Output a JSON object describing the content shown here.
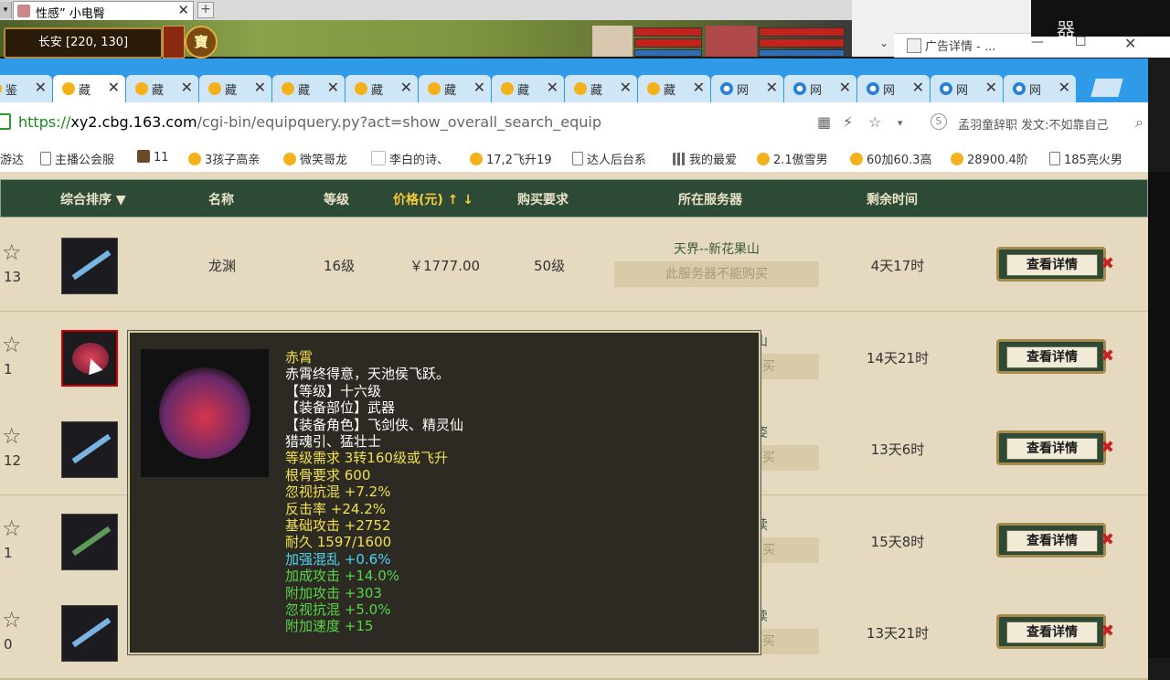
{
  "game": {
    "tab_title": "性感” 小电臀",
    "location": "长安 [220, 130]",
    "bao_badge": "寶"
  },
  "popup": {
    "title": "广告详情 - ...",
    "min": "—",
    "max": "☐",
    "close": "✕",
    "chev": "⌄",
    "watermark": "器"
  },
  "browser": {
    "tabs": [
      {
        "label": "鉴",
        "type": "game"
      },
      {
        "label": "藏",
        "type": "game",
        "active": true
      },
      {
        "label": "藏",
        "type": "game"
      },
      {
        "label": "藏",
        "type": "game"
      },
      {
        "label": "藏",
        "type": "game"
      },
      {
        "label": "藏",
        "type": "game"
      },
      {
        "label": "藏",
        "type": "game"
      },
      {
        "label": "藏",
        "type": "game"
      },
      {
        "label": "藏",
        "type": "game"
      },
      {
        "label": "藏",
        "type": "game"
      },
      {
        "label": "网",
        "type": "ie"
      },
      {
        "label": "网",
        "type": "ie"
      },
      {
        "label": "网",
        "type": "ie"
      },
      {
        "label": "网",
        "type": "ie"
      },
      {
        "label": "网",
        "type": "ie"
      }
    ],
    "url_scheme": "https://",
    "url_domain": "xy2.cbg.163.com",
    "url_path": "/cgi-bin/equipquery.py?act=show_overall_search_equip",
    "user_text": "孟羽童辞职 发文:不如靠自己",
    "bookmarks": [
      {
        "label": "游达",
        "icon": "none"
      },
      {
        "label": "主播公会服",
        "icon": "page"
      },
      {
        "label": "11",
        "icon": "img"
      },
      {
        "label": "3孩子高亲",
        "icon": "star"
      },
      {
        "label": "微笑哥龙",
        "icon": "star"
      },
      {
        "label": "李白的诗、",
        "icon": "gu"
      },
      {
        "label": "17,2飞升19",
        "icon": "star"
      },
      {
        "label": "达人后台系",
        "icon": "page"
      },
      {
        "label": "我的最爱",
        "icon": "grid"
      },
      {
        "label": "2.1傲雪男",
        "icon": "star"
      },
      {
        "label": "60加60.3高",
        "icon": "star"
      },
      {
        "label": "28900.4阶",
        "icon": "star"
      },
      {
        "label": "185亮火男",
        "icon": "page"
      }
    ]
  },
  "table": {
    "headers": {
      "sort": "综合排序 ▼",
      "name": "名称",
      "level": "等级",
      "price": "价格(元) ↑ ↓",
      "req": "购买要求",
      "server": "所在服务器",
      "time": "剩余时间"
    },
    "rows": [
      {
        "count": "13",
        "name": "龙渊",
        "level": "16级",
        "price": "￥1777.00",
        "req": "50级",
        "server": "天界--新花果山",
        "server_note": "此服务器不能购买",
        "time": "4天17时",
        "btn": "查看详情"
      },
      {
        "count": "1",
        "server": "山",
        "server_note": "买",
        "time": "14天21时",
        "btn": "查看详情"
      },
      {
        "count": "12",
        "server": "姿",
        "server_note": "买",
        "time": "13天6时",
        "btn": "查看详情"
      },
      {
        "count": "1",
        "server": "读",
        "server_note": "买",
        "time": "15天8时",
        "btn": "查看详情"
      },
      {
        "count": "0",
        "server": "读",
        "server_note": "买",
        "time": "13天21时",
        "btn": "查看详情"
      }
    ]
  },
  "tooltip": {
    "lines": [
      {
        "text": "赤霄",
        "color": "yellow"
      },
      {
        "text": "赤霄终得意，天池侯飞跃。",
        "color": "white"
      },
      {
        "text": "【等级】十六级",
        "color": "white"
      },
      {
        "text": "【装备部位】武器",
        "color": "white"
      },
      {
        "text": "【装备角色】飞剑侠、精灵仙",
        "color": "white"
      },
      {
        "text": "猎魂引、猛壮士",
        "color": "white"
      },
      {
        "text": "等级需求 3转160级或飞升",
        "color": "yellow"
      },
      {
        "text": "根骨要求 600",
        "color": "yellow"
      },
      {
        "text": "忽视抗混 +7.2%",
        "color": "yellow"
      },
      {
        "text": "反击率 +24.2%",
        "color": "yellow"
      },
      {
        "text": "基础攻击 +2752",
        "color": "yellow"
      },
      {
        "text": "耐久 1597/1600",
        "color": "yellow"
      },
      {
        "text": "加强混乱 +0.6%",
        "color": "cyan"
      },
      {
        "text": "加成攻击 +14.0%",
        "color": "green"
      },
      {
        "text": "附加攻击 +303",
        "color": "green"
      },
      {
        "text": "忽视抗混 +5.0%",
        "color": "green"
      },
      {
        "text": "附加速度 +15",
        "color": "green"
      }
    ]
  }
}
